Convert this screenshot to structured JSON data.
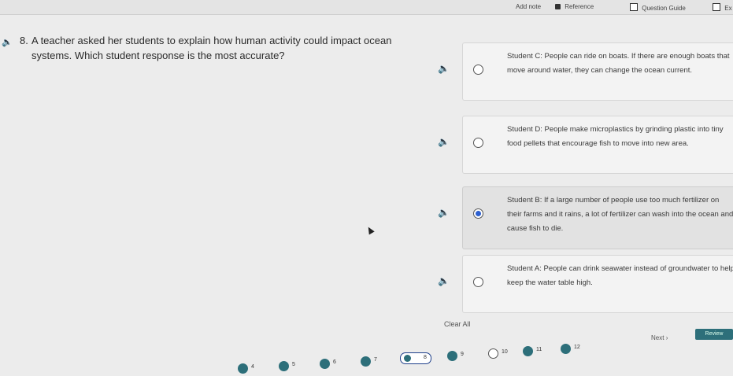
{
  "toolbar": {
    "items": [
      {
        "label": "Add note",
        "icon": "note-icon"
      },
      {
        "label": "Reference",
        "icon": "reference-icon"
      },
      {
        "label": "Question Guide",
        "icon": "checkbox-icon"
      },
      {
        "label": "Ex",
        "icon": "exit-icon"
      }
    ]
  },
  "question": {
    "number": "8.",
    "text": "A teacher asked her students to explain how human activity could impact ocean systems. Which student response is the most accurate?"
  },
  "choices": [
    {
      "text": "Student C: People can ride on boats. If there are enough boats that move around water, they can change the ocean current.",
      "selected": false
    },
    {
      "text": "Student D: People make microplastics by grinding plastic into tiny food pellets that encourage fish to move into new area.",
      "selected": false
    },
    {
      "text": "Student B: If a large number of people use too much fertilizer on their farms and it rains, a lot of fertilizer can wash into the ocean and cause fish to die.",
      "selected": true
    },
    {
      "text": "Student A: People can drink seawater instead of groundwater to help keep the water table high.",
      "selected": false
    }
  ],
  "actions": {
    "clear_label": "Clear All",
    "next_label": "Next",
    "review_label": "Review"
  },
  "navigator": {
    "items": [
      {
        "number": "4",
        "status": "answered"
      },
      {
        "number": "5",
        "status": "answered"
      },
      {
        "number": "6",
        "status": "answered"
      },
      {
        "number": "7",
        "status": "answered"
      },
      {
        "number": "8",
        "status": "current"
      },
      {
        "number": "9",
        "status": "answered"
      },
      {
        "number": "10",
        "status": "unanswered"
      },
      {
        "number": "11",
        "status": "answered"
      },
      {
        "number": "12",
        "status": "answered"
      }
    ]
  },
  "colors": {
    "accent": "#2d6f7a",
    "selected_radio": "#2c5fd0",
    "background": "#ececec"
  }
}
